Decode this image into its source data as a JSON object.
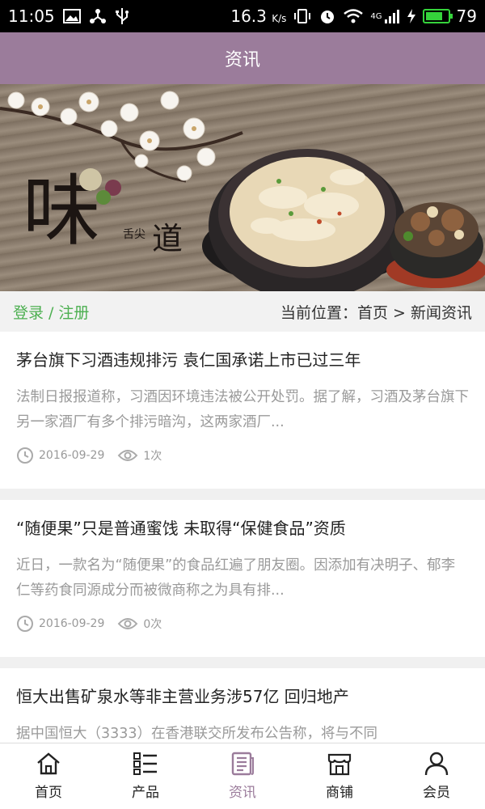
{
  "status_bar": {
    "time": "11:05",
    "speed": "16.3",
    "speed_unit": "K/s",
    "network": "4G",
    "battery": "79",
    "colors": {
      "battery": "#35d33b"
    }
  },
  "header": {
    "title": "资讯"
  },
  "banner": {
    "title_char": "味",
    "subtitle": "舌尖",
    "subtitle_char": "道"
  },
  "location_bar": {
    "login": "登录",
    "separator": "/",
    "register": "注册",
    "breadcrumb": "当前位置：首页 > 新闻资讯"
  },
  "news": [
    {
      "title": "茅台旗下习酒违规排污 袁仁国承诺上市已过三年",
      "summary": "法制日报报道称，习酒因环境违法被公开处罚。据了解，习酒及茅台旗下另一家酒厂有多个排污暗沟，这两家酒厂...",
      "date": "2016-09-29",
      "views": "1次"
    },
    {
      "title": "“随便果”只是普通蜜饯 未取得“保健食品”资质",
      "summary": "近日，一款名为“随便果”的食品红遍了朋友圈。因添加有决明子、郁李仁等药食同源成分而被微商称之为具有排...",
      "date": "2016-09-29",
      "views": "0次"
    },
    {
      "title": "恒大出售矿泉水等非主营业务涉57亿 回归地产",
      "summary": "据中国恒大（3333）在香港联交所发布公告称，将与不同",
      "date": "",
      "views": ""
    }
  ],
  "tabs": [
    {
      "label": "首页",
      "icon": "home-icon"
    },
    {
      "label": "产品",
      "icon": "list-icon"
    },
    {
      "label": "资讯",
      "icon": "news-icon",
      "active": true
    },
    {
      "label": "商铺",
      "icon": "shop-icon"
    },
    {
      "label": "会员",
      "icon": "user-icon"
    }
  ],
  "colors": {
    "accent": "#9b7c9b",
    "login_link": "#4caf50",
    "summary_text": "#9a9a9a"
  }
}
